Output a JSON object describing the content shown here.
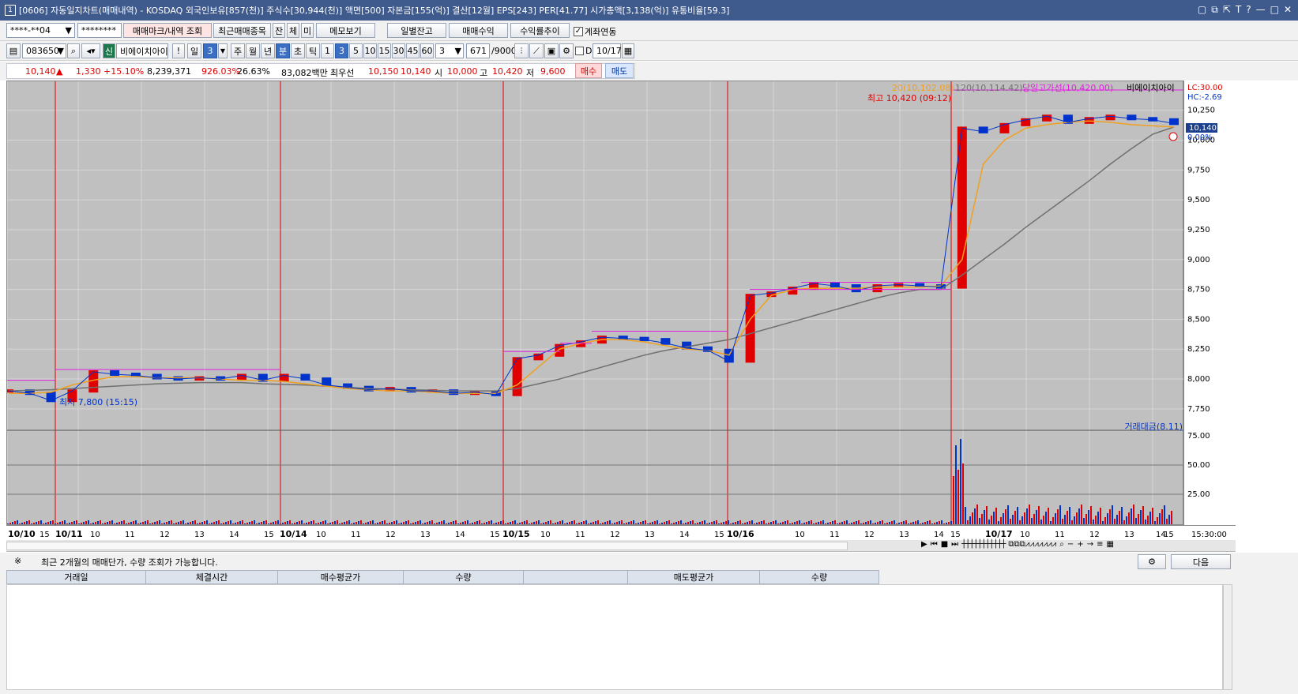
{
  "window": {
    "title": "[0606] 자동일지차트(매매내역) - KOSDAQ 외국인보유[857(천)] 주식수[30,944(천)] 액면[500] 자본금[155(억)] 결산[12월] EPS[243] PER[41.77] 시가총액[3,138(억)] 유통비율[59.3]",
    "icon_label": "1"
  },
  "toolbar1": {
    "account": "****-**04",
    "password": "********",
    "btn_mark": "매매마크/내역 조회",
    "btn_recent": "최근매매종목",
    "btn_jan": "잔",
    "btn_che": "체",
    "btn_mi": "미",
    "btn_memo": "메모보기",
    "btn_daily": "일별잔고",
    "btn_profit": "매매수익",
    "btn_rate": "수익률추이",
    "chk_account": "계좌연동"
  },
  "toolbar2": {
    "code": "083650",
    "sin": "신",
    "stock_name": "비에이치아이",
    "excl": "!",
    "il": "일",
    "num3": "3",
    "ju": "주",
    "wol": "월",
    "nyeon": "년",
    "bun": "분",
    "cho": "초",
    "tik": "틱",
    "periods": [
      "1",
      "3",
      "5",
      "10",
      "15",
      "30",
      "45",
      "60"
    ],
    "count": "3",
    "page": "671",
    "page_total": "/9000",
    "d_label": "D",
    "date": "10/17"
  },
  "quote": {
    "price": "10,140",
    "change": "1,330",
    "change_pct": "+15.10%",
    "volume": "8,239,371",
    "vol_pct": "926.03%",
    "turnover": "26.63%",
    "amount": "83,082백만",
    "best_label": "최우선",
    "best_ask": "10,150",
    "best_bid": "10,140",
    "open_label": "시",
    "open": "10,000",
    "high_label": "고",
    "high": "10,420",
    "low_label": "저",
    "low": "9,600",
    "buy_btn": "매수",
    "sell_btn": "매도"
  },
  "chart_legend": {
    "ma20": "20(10,102.08)",
    "ma120": "120(10,114.42)",
    "high_line": "당일고가선(10,420.00)",
    "stock": "비에이치아이",
    "lc": "LC:30.00",
    "hc": "HC:-2.69",
    "max_label": "최고 10,420 (09:12)",
    "min_label": "최저 7,800 (15:15)",
    "volume_legend": "거래대금(8.11)",
    "current_price": "10,140",
    "current_pct": "0.00%"
  },
  "chart_data": {
    "type": "line",
    "price_axis": [
      "10,250",
      "10,000",
      "9,750",
      "9,500",
      "9,250",
      "9,000",
      "8,750",
      "8,500",
      "8,250",
      "8,000",
      "7,750"
    ],
    "volume_axis": [
      "75.00",
      "50.00",
      "25.00"
    ],
    "x_labels": [
      "10/10",
      "15",
      "10/11",
      "10",
      "11",
      "12",
      "13",
      "14",
      "15",
      "10/14",
      "10",
      "11",
      "12",
      "13",
      "14",
      "15",
      "10/15",
      "10",
      "11",
      "12",
      "13",
      "14",
      "15",
      "10/16",
      "10",
      "11",
      "12",
      "13",
      "14",
      "15",
      "10/17",
      "10",
      "11",
      "12",
      "13",
      "14",
      "15"
    ],
    "x_end": "15:30:00",
    "price_series": [
      7900,
      7880,
      7820,
      7900,
      8060,
      8040,
      8030,
      8010,
      8000,
      8010,
      8000,
      8030,
      7990,
      8030,
      8000,
      7950,
      7930,
      7910,
      7920,
      7900,
      7900,
      7880,
      7890,
      7870,
      8170,
      8200,
      8280,
      8310,
      8350,
      8340,
      8330,
      8300,
      8260,
      8240,
      8150,
      8700,
      8720,
      8760,
      8800,
      8780,
      8740,
      8780,
      8790,
      8780,
      8770,
      10100,
      10070,
      10130,
      10170,
      10200,
      10150,
      10180,
      10200,
      10180,
      10170,
      10140
    ],
    "ma20_series": [
      7880,
      7880,
      7890,
      7950,
      7990,
      8020,
      8020,
      8010,
      8010,
      8010,
      8000,
      7990,
      7990,
      7980,
      7960,
      7940,
      7920,
      7910,
      7900,
      7900,
      7890,
      7880,
      7880,
      7880,
      7950,
      8100,
      8250,
      8300,
      8330,
      8330,
      8310,
      8280,
      8250,
      8240,
      8200,
      8500,
      8700,
      8750,
      8760,
      8760,
      8760,
      8770,
      8770,
      8770,
      8780,
      9000,
      9800,
      10000,
      10100,
      10130,
      10150,
      10160,
      10150,
      10130,
      10120,
      10110
    ],
    "ma120_series": [
      7900,
      7905,
      7910,
      7920,
      7930,
      7940,
      7950,
      7960,
      7965,
      7970,
      7970,
      7970,
      7960,
      7955,
      7950,
      7940,
      7930,
      7920,
      7915,
      7910,
      7905,
      7900,
      7900,
      7900,
      7920,
      7960,
      8000,
      8050,
      8100,
      8150,
      8200,
      8240,
      8270,
      8300,
      8330,
      8380,
      8430,
      8480,
      8530,
      8580,
      8630,
      8680,
      8720,
      8750,
      8750,
      8870,
      9000,
      9130,
      9270,
      9400,
      9530,
      9660,
      9800,
      9930,
      10050,
      10110
    ]
  },
  "bottom": {
    "note_mark": "※",
    "note": "최근 2개월의 매매단가, 수량 조회가 가능합니다.",
    "next_btn": "다음",
    "columns": [
      "거래일",
      "체결시간",
      "매수평균가",
      "수량",
      "",
      "매도평균가",
      "수량"
    ]
  }
}
